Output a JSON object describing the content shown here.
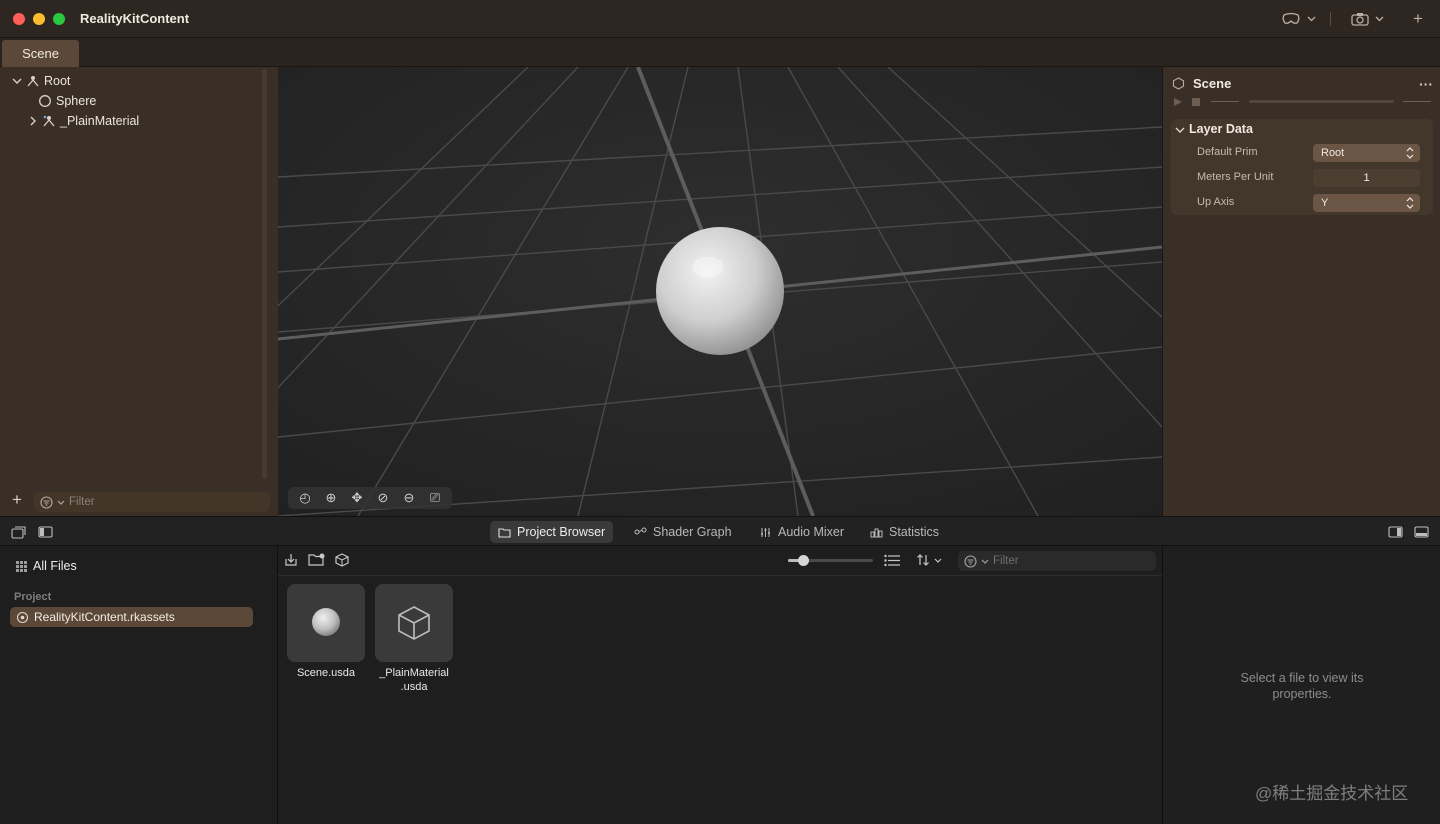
{
  "window": {
    "title": "RealityKitContent"
  },
  "tabs": {
    "scene": "Scene"
  },
  "hierarchy": {
    "items": [
      {
        "label": "Root"
      },
      {
        "label": "Sphere"
      },
      {
        "label": "_PlainMaterial"
      }
    ],
    "filter_placeholder": "Filter"
  },
  "inspector": {
    "title": "Scene",
    "section_title": "Layer Data",
    "rows": [
      {
        "label": "Default Prim",
        "value": "Root"
      },
      {
        "label": "Meters Per Unit",
        "value": "1"
      },
      {
        "label": "Up Axis",
        "value": "Y"
      }
    ]
  },
  "bottom_tabs": [
    {
      "label": "Project Browser"
    },
    {
      "label": "Shader Graph"
    },
    {
      "label": "Audio Mixer"
    },
    {
      "label": "Statistics"
    }
  ],
  "files_sidebar": {
    "all_files": "All Files",
    "section": "Project",
    "selected": "RealityKitContent.rkassets"
  },
  "browser": {
    "filter_placeholder": "Filter",
    "files": [
      {
        "name": "Scene.usda"
      },
      {
        "name_line1": "_PlainMaterial",
        "name_line2": ".usda"
      }
    ]
  },
  "properties": {
    "empty_line1": "Select a file to view its",
    "empty_line2": "properties."
  },
  "watermark": "@稀土掘金技术社区"
}
